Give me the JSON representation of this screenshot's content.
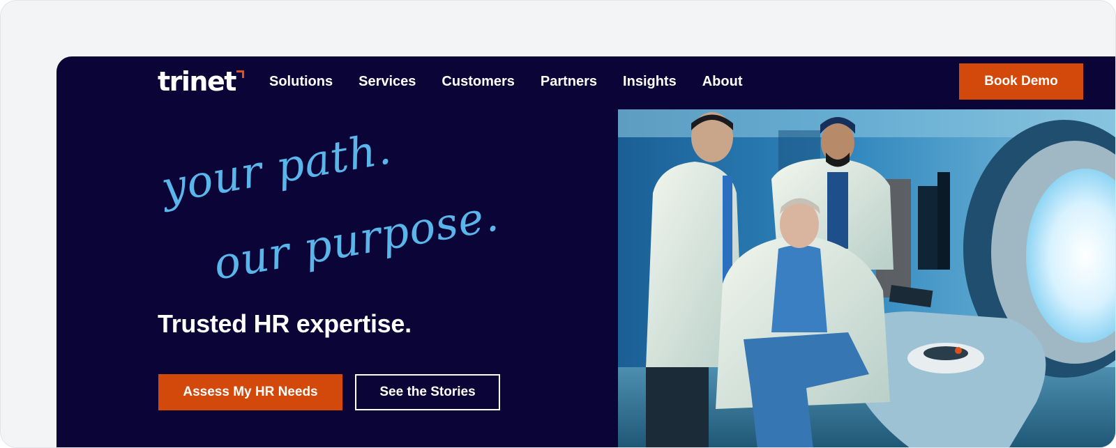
{
  "brand": {
    "logo_text": "trinet",
    "accent_color": "#d3490c",
    "background_color": "#0b0436",
    "script_color": "#5ab6ea"
  },
  "nav": {
    "items": [
      {
        "label": "Solutions"
      },
      {
        "label": "Services"
      },
      {
        "label": "Customers"
      },
      {
        "label": "Partners"
      },
      {
        "label": "Insights"
      },
      {
        "label": "About"
      }
    ],
    "cta_label": "Book Demo"
  },
  "hero": {
    "script_line_1": "your path.",
    "script_line_2": "our purpose.",
    "tagline": "Trusted HR expertise.",
    "primary_cta": "Assess My HR Needs",
    "secondary_cta": "See the Stories",
    "image_alt": "Three doctors in white coats beside a medical imaging machine"
  }
}
